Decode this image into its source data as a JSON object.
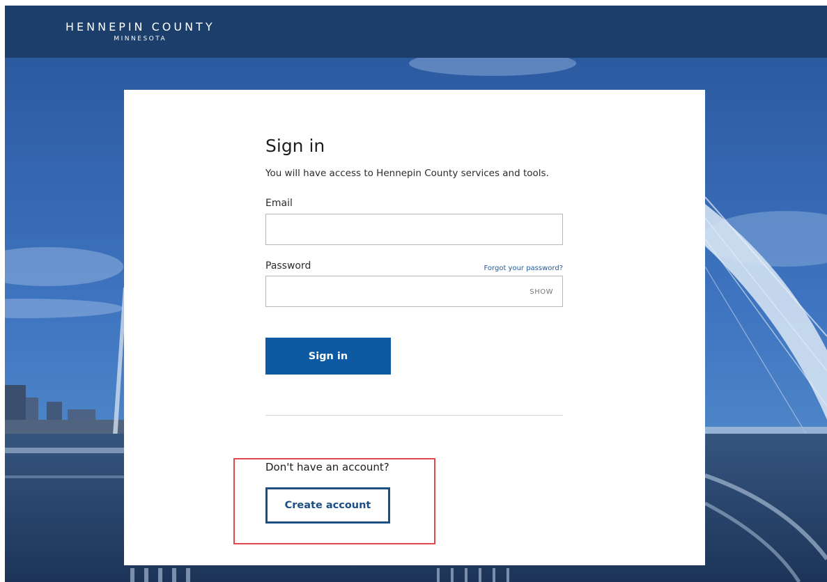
{
  "header": {
    "logo_main": "HENNEPIN COUNTY",
    "logo_sub": "MINNESOTA",
    "bar_color": "#1b3e6b"
  },
  "signin": {
    "title": "Sign in",
    "subtitle": "You will have access to Hennepin County services and tools.",
    "email_label": "Email",
    "email_value": "",
    "password_label": "Password",
    "password_value": "",
    "forgot_link": "Forgot your password?",
    "show_toggle": "SHOW",
    "submit_label": "Sign in",
    "submit_color": "#0d5aa3"
  },
  "signup": {
    "prompt": "Don't have an account?",
    "create_label": "Create account",
    "highlight_color": "#e0474c"
  }
}
